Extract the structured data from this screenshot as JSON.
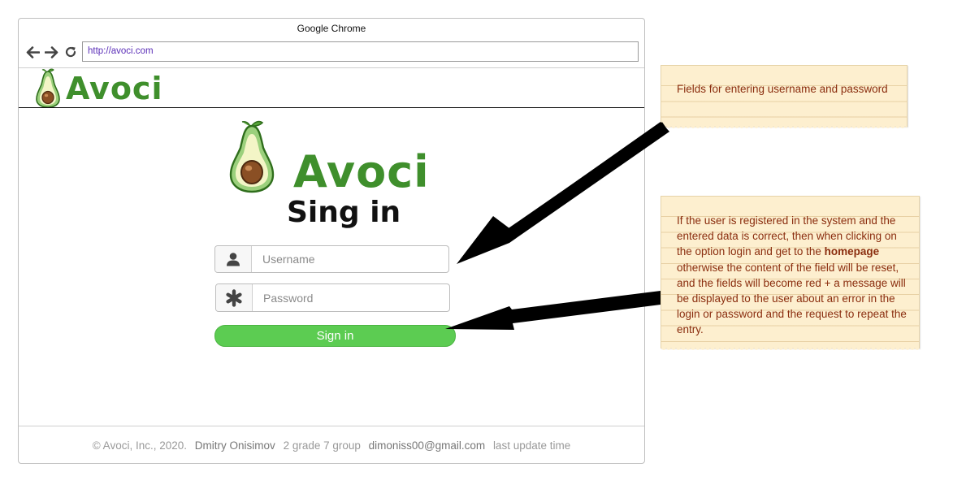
{
  "browser": {
    "window_title": "Google Chrome",
    "url": "http://avoci.com"
  },
  "site": {
    "brand": "Avoci",
    "signin_title": "Sing in"
  },
  "form": {
    "username_placeholder": "Username",
    "password_placeholder": "Password",
    "signin_label": "Sign in",
    "button_color": "#5ccc52"
  },
  "footer": {
    "copyright": "© Avoci, Inc., 2020.",
    "author": "Dmitry Onisimov",
    "group": "2 grade 7 group",
    "email": "dimoniss00@gmail.com",
    "update": "last update time"
  },
  "notes": {
    "note1": "Fields for entering username and password",
    "note2_part1": "If the user is registered in the system and the entered data is correct, then when clicking on the option login and get to the",
    "note2_bold": "homepage",
    "note2_part2": "otherwise the content of the field will be reset, and the fields will become red + a message will be displayed to the user about an error in the login or password and the request to repeat the entry."
  },
  "colors": {
    "brand_green": "#3f8f2c",
    "note_bg": "#fdefcf",
    "note_text": "#8a2d0e"
  }
}
